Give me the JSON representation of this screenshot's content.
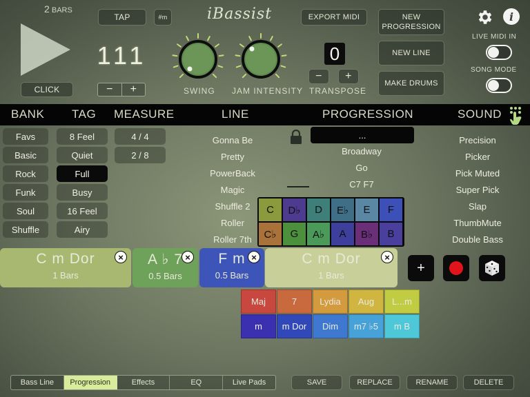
{
  "transport": {
    "bars_count": "2",
    "bars_unit": "BARS",
    "click_label": "CLICK",
    "tap_label": "TAP",
    "hash_label": "#m",
    "tempo": "111",
    "tempo_minus": "−",
    "tempo_plus": "+"
  },
  "logo": "iBassist",
  "knobs": {
    "swing_label": "SWING",
    "jam_label": "JAM INTENSITY"
  },
  "export_label": "EXPORT MIDI",
  "transpose": {
    "value": "0",
    "minus": "−",
    "plus": "+",
    "label": "TRANSPOSE"
  },
  "actions": {
    "new_progression": "NEW PROGRESSION",
    "new_line": "NEW LINE",
    "make_drums": "MAKE DRUMS"
  },
  "toggles": {
    "live_midi_label": "LIVE MIDI IN",
    "song_mode_label": "SONG MODE"
  },
  "headers": {
    "bank": "BANK",
    "tag": "TAG",
    "measure": "MEASURE",
    "line": "LINE",
    "progression": "PROGRESSION",
    "sound": "SOUND"
  },
  "banks": [
    "Favs",
    "Basic",
    "Rock",
    "Funk",
    "Soul",
    "Shuffle"
  ],
  "tags": [
    "8 Feel",
    "Quiet",
    "Full",
    "Busy",
    "16 Feel",
    "Airy"
  ],
  "tags_selected": "Full",
  "measures": [
    "4 / 4",
    "2 / 8"
  ],
  "lines": [
    "Gonna Be",
    "Pretty",
    "PowerBack",
    "Magic",
    "Shuffle 2",
    "Roller",
    "Roller 7th"
  ],
  "progressions": {
    "selected": "...",
    "items": [
      "Broadway",
      "Go",
      "C7 F7"
    ]
  },
  "sounds": [
    "Precision",
    "Picker",
    "Pick Muted",
    "Super Pick",
    "Slap",
    "ThumbMute",
    "Double Bass"
  ],
  "keys": [
    [
      "C",
      "D♭",
      "D",
      "E♭",
      "E",
      "F"
    ],
    [
      "C♭",
      "G",
      "A♭",
      "A",
      "B♭",
      "B"
    ]
  ],
  "key_colors": [
    [
      "#8a9a3c",
      "#4c3b8e",
      "#3f7f7a",
      "#3f6f86",
      "#5a88a4",
      "#3d50b8"
    ],
    [
      "#a8723a",
      "#4c8f3c",
      "#4c9a5a",
      "#3e3f9c",
      "#6a2f78",
      "#4a3f9c"
    ]
  ],
  "chord_pads": [
    {
      "chord": "C m Dor",
      "bars": "1 Bars",
      "color": "#a8b870"
    },
    {
      "chord": "A ♭ 7",
      "bars": "0.5 Bars",
      "color": "#6ea25a"
    },
    {
      "chord": "F m",
      "bars": "0.5 Bars",
      "color": "#3d55b8"
    },
    {
      "chord": "C m Dor",
      "bars": "1 Bars",
      "color": "#c8cf98"
    }
  ],
  "pad_remove_symbol": "×",
  "add_symbol": "+",
  "chord_types": [
    [
      {
        "label": "Maj",
        "color": "#c8473e"
      },
      {
        "label": "7",
        "color": "#c86a3e"
      },
      {
        "label": "Lydia",
        "color": "#d49a3e"
      },
      {
        "label": "Aug",
        "color": "#d0b640"
      },
      {
        "label": "L...m",
        "color": "#c2cc42"
      }
    ],
    [
      {
        "label": "m",
        "color": "#3a30b0"
      },
      {
        "label": "m Dor",
        "color": "#3048b8"
      },
      {
        "label": "Dim",
        "color": "#3f78d0"
      },
      {
        "label": "m7 ♭5",
        "color": "#46a2d8"
      },
      {
        "label": "m B",
        "color": "#4ec8d8"
      }
    ]
  ],
  "tabs": [
    "Bass Line",
    "Progression",
    "Effects",
    "EQ",
    "Live Pads"
  ],
  "active_tab": "Progression",
  "bottom_actions": [
    "SAVE",
    "REPLACE",
    "RENAME",
    "DELETE"
  ],
  "colors": {
    "accent_tab": "#d8ec9c",
    "record": "#e0141a",
    "knob": "#5f8a4e"
  }
}
